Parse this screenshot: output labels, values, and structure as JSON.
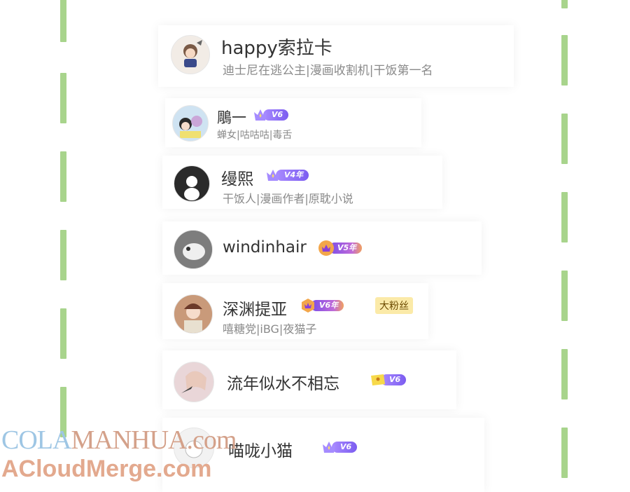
{
  "colors": {
    "rail": "#a8d48c",
    "badge_purple": "#7b5cf0",
    "fan_tag_bg": "#fbeaa8"
  },
  "users": [
    {
      "name": "happy索拉卡",
      "bio": "迪士尼在逃公主|漫画收割机|干饭第一名",
      "avatar_icon": "anime-avatar-icon"
    },
    {
      "name": "鵰一",
      "badge": "V6",
      "bio": "蝉女|咕咕咕|毒舌",
      "avatar_icon": "anime-avatar-icon"
    },
    {
      "name": "缦熙",
      "badge": "V4年",
      "bio": "干饭人|漫画作者|原耽小说",
      "avatar_icon": "default-avatar-icon"
    },
    {
      "name": "windinhair",
      "badge": "V5年",
      "bio": "",
      "avatar_icon": "photo-avatar-icon"
    },
    {
      "name": "深渊提亚",
      "badge": "V6年",
      "fan_tag": "大粉丝",
      "bio": "嘻糖党|iBG|夜猫子",
      "avatar_icon": "anime-avatar-icon"
    },
    {
      "name": "流年似水不相忘",
      "badge": "V6",
      "bio": "",
      "avatar_icon": "anime-avatar-icon"
    },
    {
      "name": "喵咙小猫",
      "badge": "V6",
      "bio": "",
      "avatar_icon": "anime-avatar-icon"
    }
  ],
  "watermark": {
    "line1_a": "COLA",
    "line1_b": "MANHUA",
    "line1_c": ".com",
    "line2": "ACloudMerge.com"
  }
}
